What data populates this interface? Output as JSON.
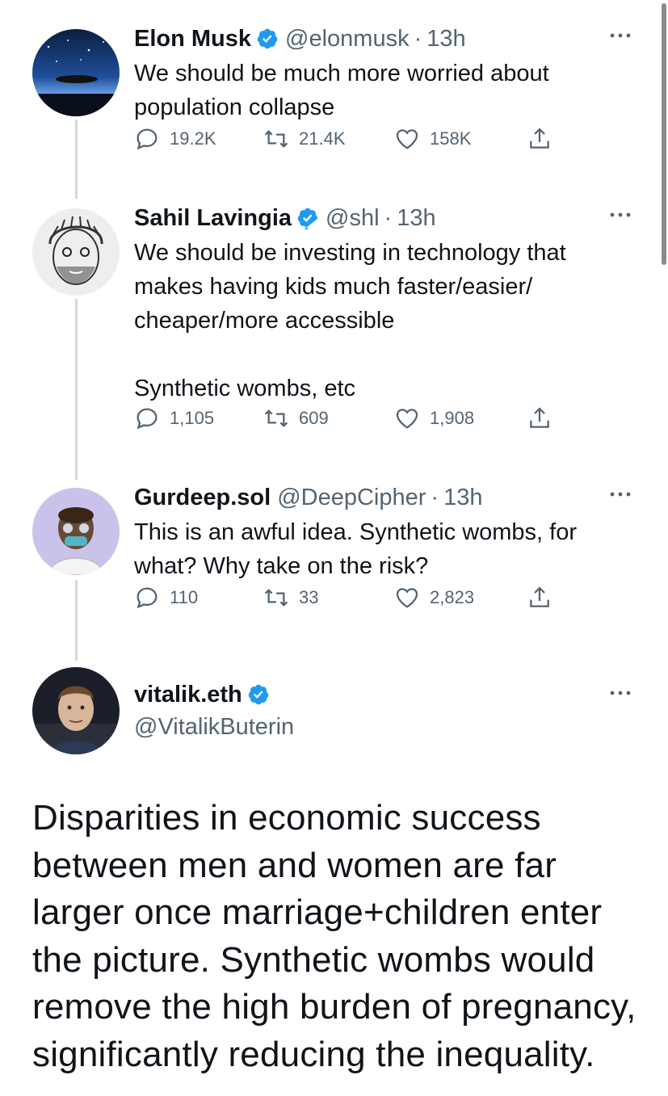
{
  "tweets": [
    {
      "name": "Elon Musk",
      "verified": true,
      "handle": "@elonmusk",
      "separator": "·",
      "time": "13h",
      "text": "We should be much more worried about\npopulation collapse",
      "replies": "19.2K",
      "retweets": "21.4K",
      "likes": "158K"
    },
    {
      "name": "Sahil Lavingia",
      "verified": true,
      "handle": "@shl",
      "separator": "·",
      "time": "13h",
      "text": "We should be investing in technology that\nmakes having kids much faster/easier/\ncheaper/more accessible\n\nSynthetic wombs, etc",
      "replies": "1,105",
      "retweets": "609",
      "likes": "1,908"
    },
    {
      "name": "Gurdeep.sol",
      "verified": false,
      "handle": "@DeepCipher",
      "separator": "·",
      "time": "13h",
      "text": "This is an awful idea. Synthetic wombs, for\nwhat? Why take on the risk?",
      "replies": "110",
      "retweets": "33",
      "likes": "2,823"
    }
  ],
  "main_tweet": {
    "name": "vitalik.eth",
    "verified": true,
    "handle": "@VitalikButerin",
    "text": "Disparities in economic success between men and women are far larger once marriage+children enter the picture. Synthetic wombs would remove the high burden of pregnancy, significantly reducing the inequality."
  },
  "colors": {
    "verified_blue": "#1d9bf0",
    "secondary_text": "#536471",
    "thread_line": "#cfd9de"
  },
  "icons": [
    "reply-icon",
    "retweet-icon",
    "like-icon",
    "share-icon",
    "more-icon",
    "verified-badge-icon"
  ]
}
